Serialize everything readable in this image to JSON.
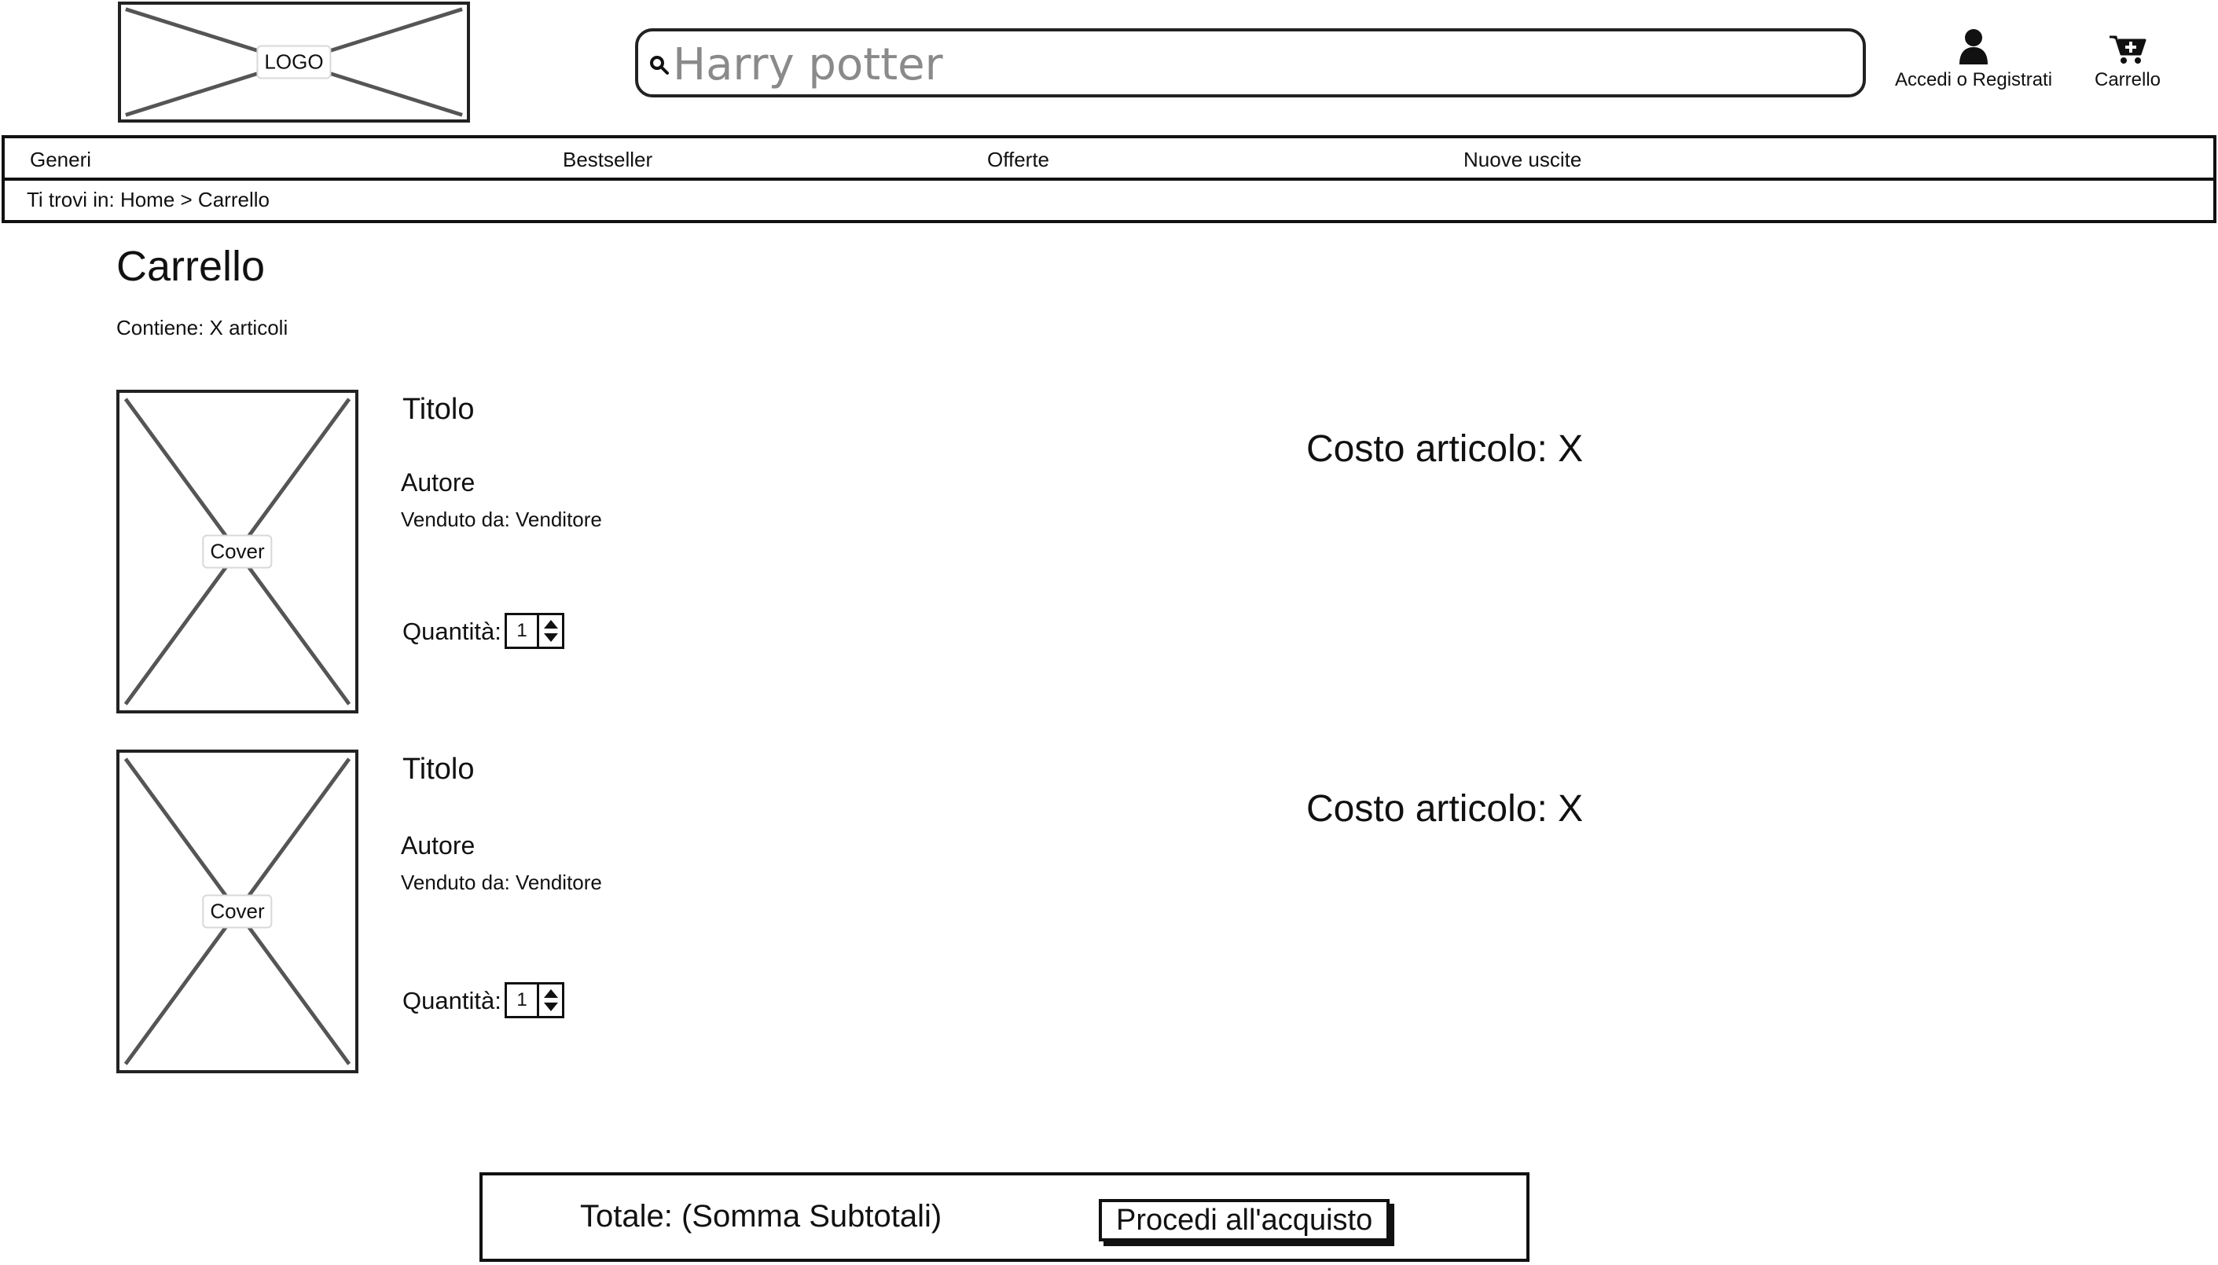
{
  "header": {
    "logo_label": "LOGO",
    "search": {
      "value": "",
      "placeholder": "Harry potter"
    },
    "account_label": "Accedi o Registrati",
    "cart_label": "Carrello"
  },
  "nav": {
    "items": [
      {
        "label": "Generi"
      },
      {
        "label": "Bestseller"
      },
      {
        "label": "Offerte"
      },
      {
        "label": "Nuove uscite"
      }
    ]
  },
  "breadcrumb": {
    "text": "Ti trovi in: Home > Carrello"
  },
  "page": {
    "title": "Carrello",
    "count_text": "Contiene: X articoli"
  },
  "cart_items": [
    {
      "cover_label": "Cover",
      "title": "Titolo",
      "author": "Autore",
      "seller": "Venduto da: Venditore",
      "quantity_label": "Quantità:",
      "quantity": "1",
      "price": "Costo articolo: X"
    },
    {
      "cover_label": "Cover",
      "title": "Titolo",
      "author": "Autore",
      "seller": "Venduto da: Venditore",
      "quantity_label": "Quantità:",
      "quantity": "1",
      "price": "Costo articolo: X"
    }
  ],
  "summary": {
    "total_label": "Totale: (Somma Subtotali)",
    "checkout_label": "Procedi all'acquisto"
  },
  "colors": {
    "border": "#111111",
    "placeholder_lines": "#555555",
    "search_text": "#8a8a8a"
  }
}
